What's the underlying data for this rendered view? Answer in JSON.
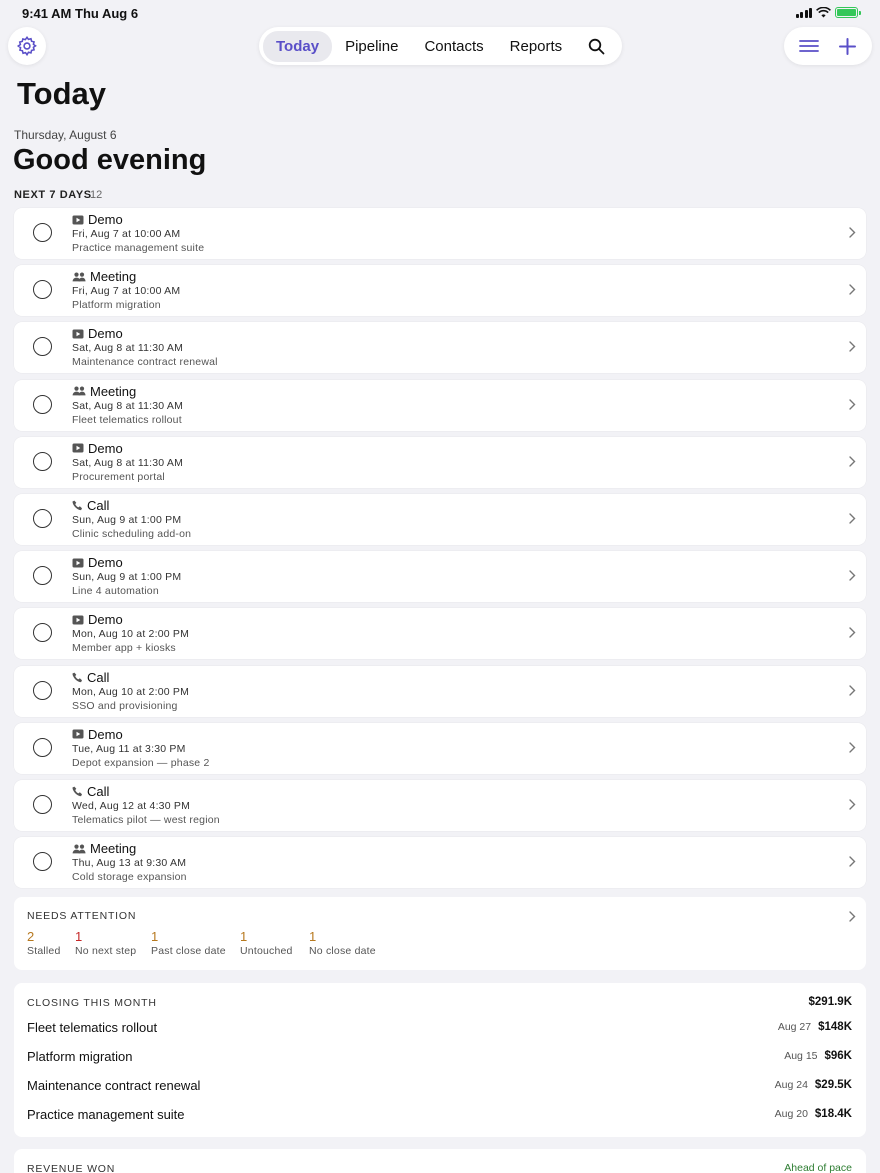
{
  "status": {
    "time": "9:41 AM",
    "date": "Thu Aug 6"
  },
  "nav": {
    "tabs": [
      "Today",
      "Pipeline",
      "Contacts",
      "Reports"
    ],
    "active": "Today"
  },
  "page": {
    "title": "Today",
    "date": "Thursday, August 6",
    "greeting": "Good evening"
  },
  "upcoming": {
    "label": "NEXT 7 DAYS",
    "count": "12",
    "tasks": [
      {
        "type": "Demo",
        "icon": "video-icon",
        "when": "Fri, Aug 7 at 10:00 AM",
        "deal": "Practice management suite"
      },
      {
        "type": "Meeting",
        "icon": "people-icon",
        "when": "Fri, Aug 7 at 10:00 AM",
        "deal": "Platform migration"
      },
      {
        "type": "Demo",
        "icon": "video-icon",
        "when": "Sat, Aug 8 at 11:30 AM",
        "deal": "Maintenance contract renewal"
      },
      {
        "type": "Meeting",
        "icon": "people-icon",
        "when": "Sat, Aug 8 at 11:30 AM",
        "deal": "Fleet telematics rollout"
      },
      {
        "type": "Demo",
        "icon": "video-icon",
        "when": "Sat, Aug 8 at 11:30 AM",
        "deal": "Procurement portal"
      },
      {
        "type": "Call",
        "icon": "phone-icon",
        "when": "Sun, Aug 9 at 1:00 PM",
        "deal": "Clinic scheduling add-on"
      },
      {
        "type": "Demo",
        "icon": "video-icon",
        "when": "Sun, Aug 9 at 1:00 PM",
        "deal": "Line 4 automation"
      },
      {
        "type": "Demo",
        "icon": "video-icon",
        "when": "Mon, Aug 10 at 2:00 PM",
        "deal": "Member app + kiosks"
      },
      {
        "type": "Call",
        "icon": "phone-icon",
        "when": "Mon, Aug 10 at 2:00 PM",
        "deal": "SSO and provisioning"
      },
      {
        "type": "Demo",
        "icon": "video-icon",
        "when": "Tue, Aug 11 at 3:30 PM",
        "deal": "Depot expansion — phase 2"
      },
      {
        "type": "Call",
        "icon": "phone-icon",
        "when": "Wed, Aug 12 at 4:30 PM",
        "deal": "Telematics pilot — west region"
      },
      {
        "type": "Meeting",
        "icon": "people-icon",
        "when": "Thu, Aug 13 at 9:30 AM",
        "deal": "Cold storage expansion"
      }
    ]
  },
  "attention": {
    "label": "NEEDS ATTENTION",
    "stats": [
      {
        "value": "2",
        "label": "Stalled",
        "color": "#b7791f"
      },
      {
        "value": "1",
        "label": "No next step",
        "color": "#c62828"
      },
      {
        "value": "1",
        "label": "Past close date",
        "color": "#b7791f"
      },
      {
        "value": "1",
        "label": "Untouched",
        "color": "#b7791f"
      },
      {
        "value": "1",
        "label": "No close date",
        "color": "#b7791f"
      }
    ]
  },
  "closing": {
    "label": "CLOSING THIS MONTH",
    "total": "$291.9K",
    "deals": [
      {
        "name": "Fleet telematics rollout",
        "date": "Aug 27",
        "amount": "$148K"
      },
      {
        "name": "Platform migration",
        "date": "Aug 15",
        "amount": "$96K"
      },
      {
        "name": "Maintenance contract renewal",
        "date": "Aug 24",
        "amount": "$29.5K"
      },
      {
        "name": "Practice management suite",
        "date": "Aug 20",
        "amount": "$18.4K"
      }
    ]
  },
  "revenue": {
    "label": "REVENUE WON",
    "pace": "Ahead of pace"
  },
  "colors": {
    "accent": "#5a4fc8",
    "background": "#f2f2f6",
    "positive": "#2e7d32"
  }
}
